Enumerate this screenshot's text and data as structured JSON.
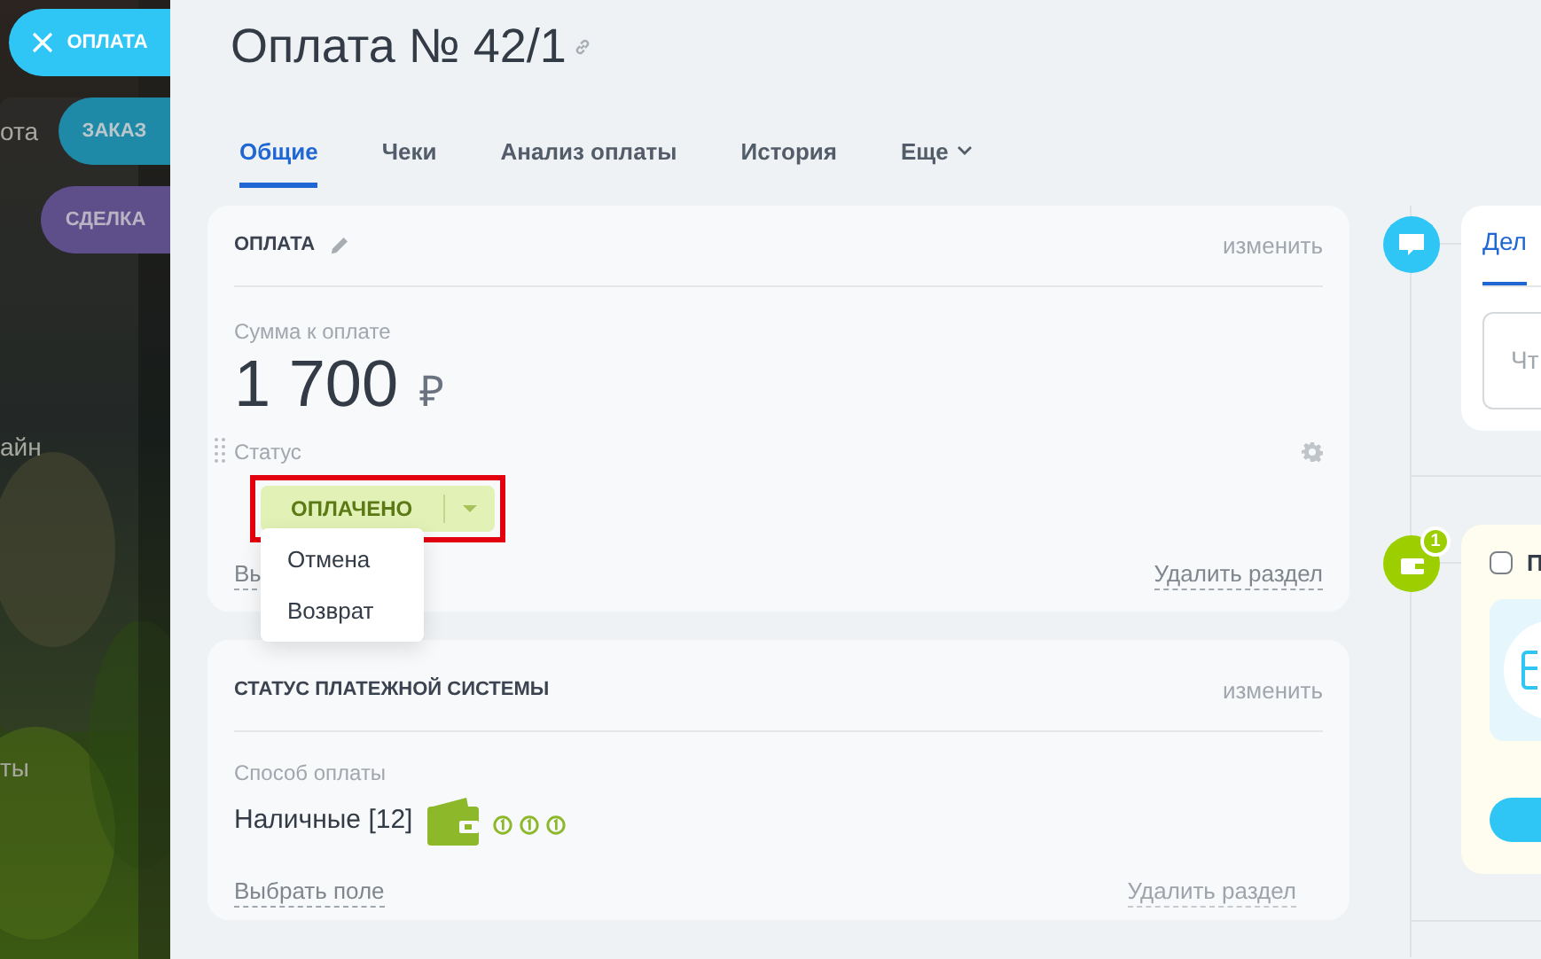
{
  "background_texts": [
    "ота",
    "айн",
    "ты"
  ],
  "side_tabs": [
    {
      "label": "ОПЛАТА",
      "kind": "current"
    },
    {
      "label": "ЗАКАЗ",
      "kind": "order"
    },
    {
      "label": "СДЕЛКА",
      "kind": "deal"
    }
  ],
  "title": "Оплата № 42/1",
  "tabs": [
    {
      "label": "Общие",
      "selected": true
    },
    {
      "label": "Чеки",
      "selected": false
    },
    {
      "label": "Анализ оплаты",
      "selected": false
    },
    {
      "label": "История",
      "selected": false
    },
    {
      "label": "Еще",
      "selected": false,
      "menu": true
    }
  ],
  "payment_section": {
    "title": "ОПЛАТА",
    "action": "изменить",
    "amount_label": "Сумма к оплате",
    "amount": "1 700",
    "currency": "₽",
    "status_label": "Статус",
    "status": "ОПЛАЧЕНО",
    "status_highlighted": true,
    "select_field": "Вы",
    "delete": "Удалить раздел",
    "status_menu": [
      {
        "label": "Отмена"
      },
      {
        "label": "Возврат"
      }
    ]
  },
  "system_section": {
    "title": "СТАТУС ПЛАТЕЖНОЙ СИСТЕМЫ",
    "action": "изменить",
    "method_label": "Способ оплаты",
    "method": "Наличные [12]",
    "select_field": "Выбрать поле",
    "delete": "Удалить раздел"
  },
  "timeline": {
    "activity_tab": "Дел",
    "activity_placeholder": "Чт",
    "badge": "1",
    "task_label": "П",
    "task_checked": false
  }
}
